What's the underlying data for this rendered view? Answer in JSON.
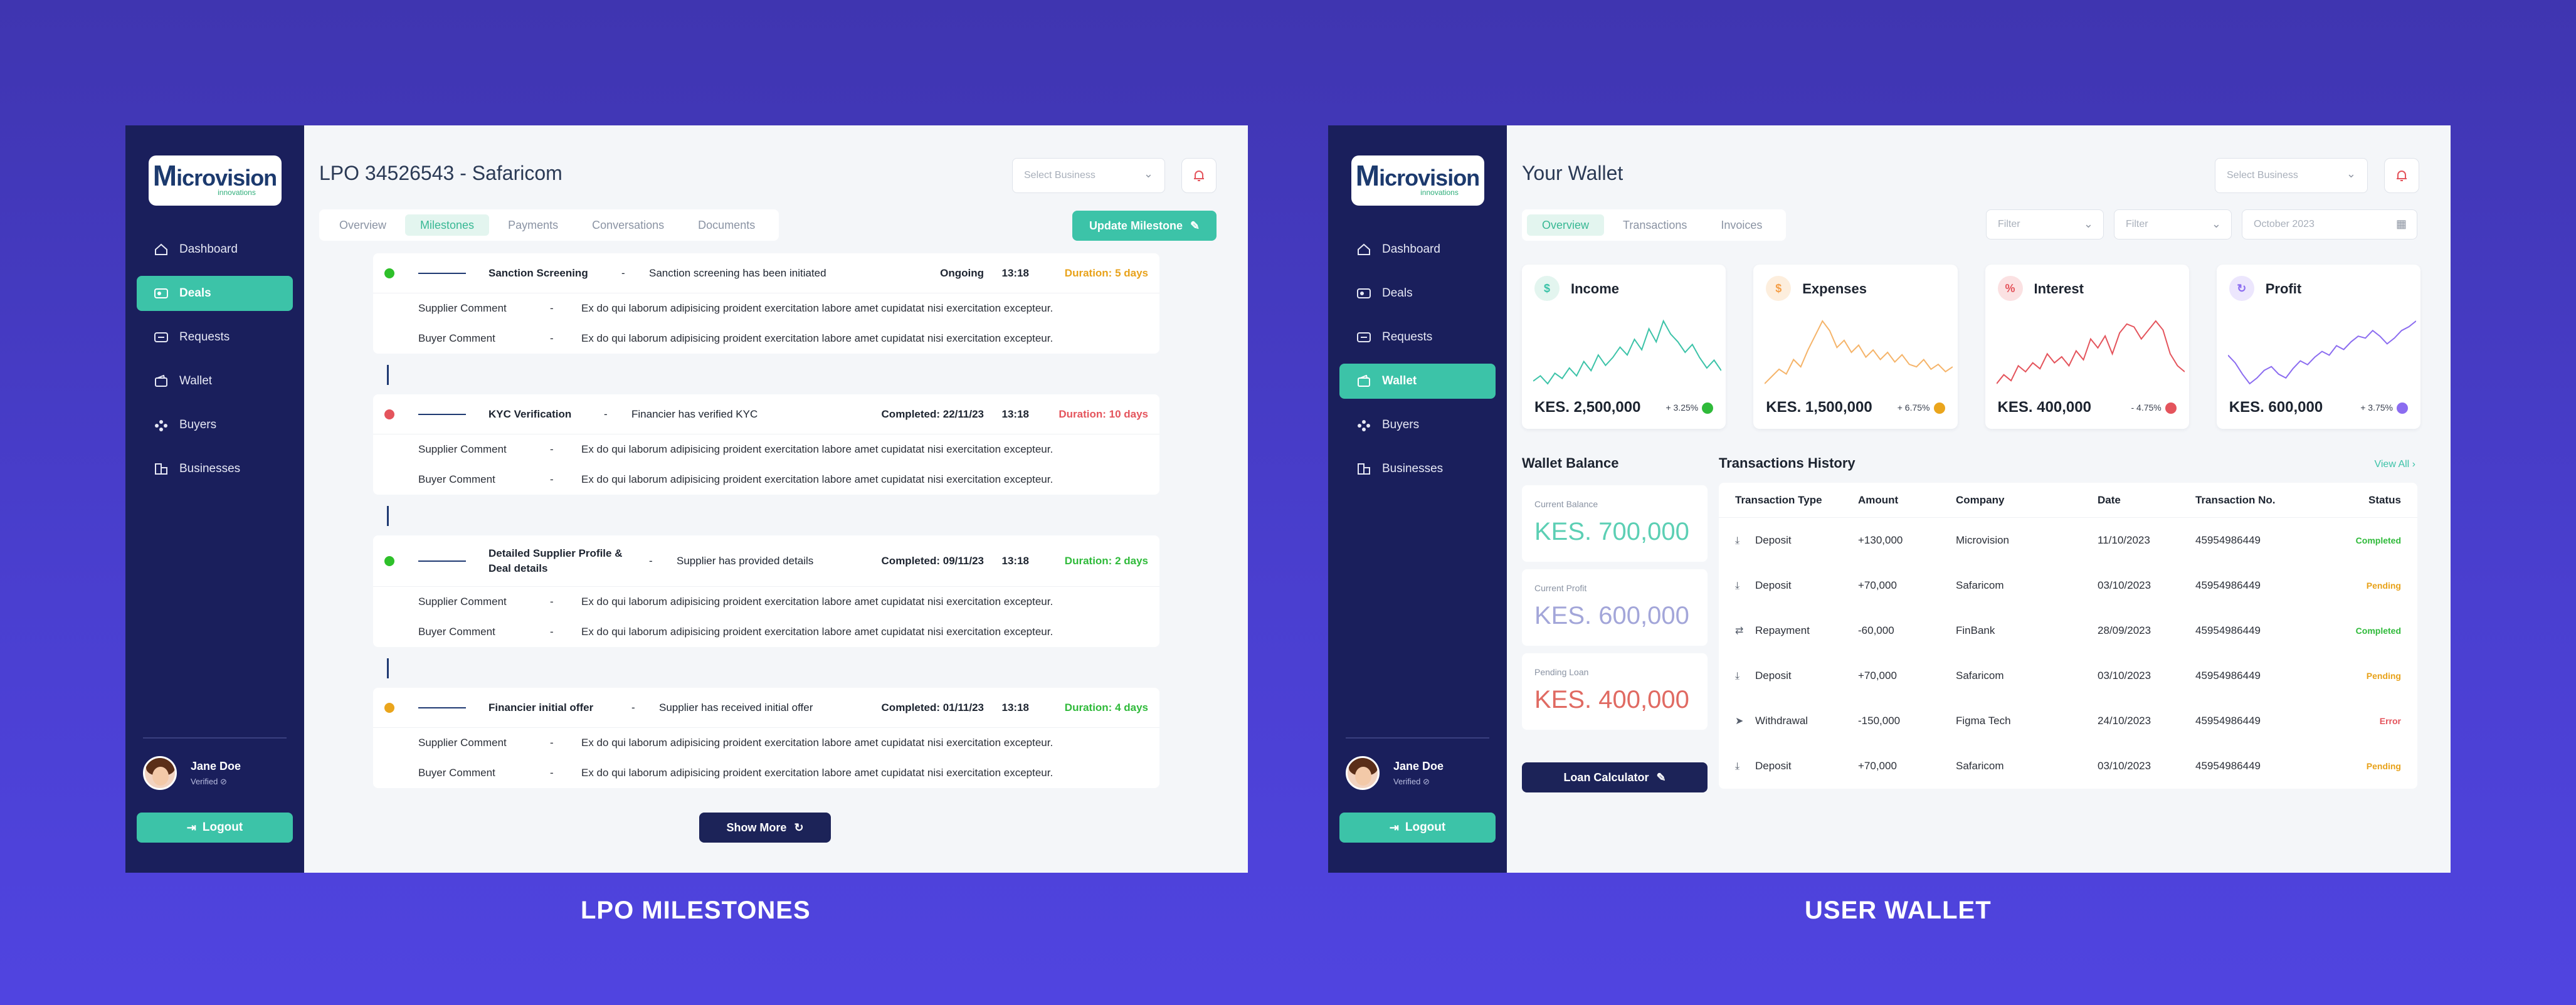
{
  "brand": {
    "logo_text": "icrovision",
    "logo_letter": "M",
    "logo_sub": "innovations"
  },
  "nav": [
    "Dashboard",
    "Deals",
    "Requests",
    "Wallet",
    "Buyers",
    "Businesses"
  ],
  "user": {
    "name": "Jane Doe",
    "status": "Verified"
  },
  "logout_label": "Logout",
  "milestones_screen": {
    "title": "LPO 34526543 - Safaricom",
    "select_placeholder": "Select Business",
    "tabs": [
      "Overview",
      "Milestones",
      "Payments",
      "Conversations",
      "Documents"
    ],
    "active_tab": "Milestones",
    "update_button": "Update Milestone",
    "milestones": [
      {
        "title": "Sanction Screening",
        "desc": "Sanction screening has been initiated",
        "status": "Ongoing",
        "time": "13:18",
        "duration": "Duration: 5 days",
        "color": "#2ec02a",
        "duration_color": "#e8a21a"
      },
      {
        "title": "KYC Verification",
        "desc": "Financier has verified KYC",
        "status": "Completed: 22/11/23",
        "time": "13:18",
        "duration": "Duration: 10 days",
        "color": "#e4545c",
        "duration_color": "#e4545c"
      },
      {
        "title": "Detailed Supplier Profile & Deal details",
        "desc": "Supplier has provided details",
        "status": "Completed: 09/11/23",
        "time": "13:18",
        "duration": "Duration: 2 days",
        "color": "#2ec02a",
        "duration_color": "#2fba3a"
      },
      {
        "title": "Financier initial offer",
        "desc": "Supplier has received initial offer",
        "status": "Completed: 01/11/23",
        "time": "13:18",
        "duration": "Duration: 4 days",
        "color": "#eaa51c",
        "duration_color": "#2fba3a"
      }
    ],
    "comment_labels": {
      "supplier": "Supplier Comment",
      "buyer": "Buyer Comment",
      "dash": "-"
    },
    "comment_text": "Ex do qui laborum adipisicing proident exercitation labore amet cupidatat nisi exercitation excepteur.",
    "show_more": "Show More",
    "caption": "LPO MILESTONES"
  },
  "wallet_screen": {
    "title": "Your Wallet",
    "select_placeholder": "Select Business",
    "tabs": [
      "Overview",
      "Transactions",
      "Invoices"
    ],
    "active_tab": "Overview",
    "filter1": "Filter",
    "filter2": "Filter",
    "date_filter": "October 2023",
    "stats": [
      {
        "label": "Income",
        "value": "KES. 2,500,000",
        "pct": "+ 3.25%",
        "color": "#3cc3a8",
        "series": [
          40,
          44,
          38,
          46,
          42,
          50,
          44,
          55,
          48,
          60,
          52,
          58,
          66,
          60,
          72,
          64,
          80,
          70,
          86,
          76,
          70,
          62,
          68,
          58,
          50,
          56,
          48
        ]
      },
      {
        "label": "Expenses",
        "value": "KES. 1,500,000",
        "pct": "+ 6.75%",
        "color": "#f5b46a",
        "series": [
          30,
          36,
          42,
          38,
          50,
          44,
          58,
          70,
          82,
          74,
          60,
          66,
          56,
          62,
          52,
          58,
          50,
          56,
          48,
          54,
          46,
          44,
          50,
          42,
          46,
          40,
          44
        ]
      },
      {
        "label": "Interest",
        "value": "KES. 400,000",
        "pct": "- 4.75%",
        "color": "#e4545c",
        "series": [
          40,
          46,
          42,
          52,
          48,
          54,
          50,
          60,
          54,
          58,
          52,
          62,
          56,
          70,
          64,
          72,
          60,
          74,
          80,
          78,
          70,
          76,
          82,
          76,
          60,
          52,
          48
        ]
      },
      {
        "label": "Profit",
        "value": "KES. 600,000",
        "pct": "+ 3.75%",
        "color": "#8b6cf0",
        "series": [
          60,
          52,
          40,
          30,
          36,
          44,
          48,
          40,
          36,
          46,
          54,
          50,
          58,
          64,
          60,
          70,
          66,
          74,
          80,
          78,
          86,
          80,
          72,
          78,
          86,
          90,
          96
        ]
      }
    ],
    "balance_title": "Wallet Balance",
    "balances": [
      {
        "label": "Current Balance",
        "value": "KES. 700,000",
        "color": "#5ccfb4"
      },
      {
        "label": "Current Profit",
        "value": "KES. 600,000",
        "color": "#a3a6d9"
      },
      {
        "label": "Pending Loan",
        "value": "KES. 400,000",
        "color": "#e06a62"
      }
    ],
    "loan_button": "Loan Calculator",
    "history_title": "Transactions History",
    "view_all": "View All",
    "columns": [
      "Transaction Type",
      "Amount",
      "Company",
      "Date",
      "Transaction No.",
      "Status"
    ],
    "transactions": [
      {
        "type": "Deposit",
        "amount": "+130,000",
        "company": "Microvision",
        "date": "11/10/2023",
        "no": "45954986449",
        "status": "Completed",
        "icon": "download-icon"
      },
      {
        "type": "Deposit",
        "amount": "+70,000",
        "company": "Safaricom",
        "date": "03/10/2023",
        "no": "45954986449",
        "status": "Pending",
        "icon": "download-icon"
      },
      {
        "type": "Repayment",
        "amount": "-60,000",
        "company": "FinBank",
        "date": "28/09/2023",
        "no": "45954986449",
        "status": "Completed",
        "icon": "repeat-icon"
      },
      {
        "type": "Deposit",
        "amount": "+70,000",
        "company": "Safaricom",
        "date": "03/10/2023",
        "no": "45954986449",
        "status": "Pending",
        "icon": "download-icon"
      },
      {
        "type": "Withdrawal",
        "amount": "-150,000",
        "company": "Figma Tech",
        "date": "24/10/2023",
        "no": "45954986449",
        "status": "Error",
        "icon": "send-icon"
      },
      {
        "type": "Deposit",
        "amount": "+70,000",
        "company": "Safaricom",
        "date": "03/10/2023",
        "no": "45954986449",
        "status": "Pending",
        "icon": "download-icon"
      }
    ],
    "caption": "USER WALLET"
  }
}
